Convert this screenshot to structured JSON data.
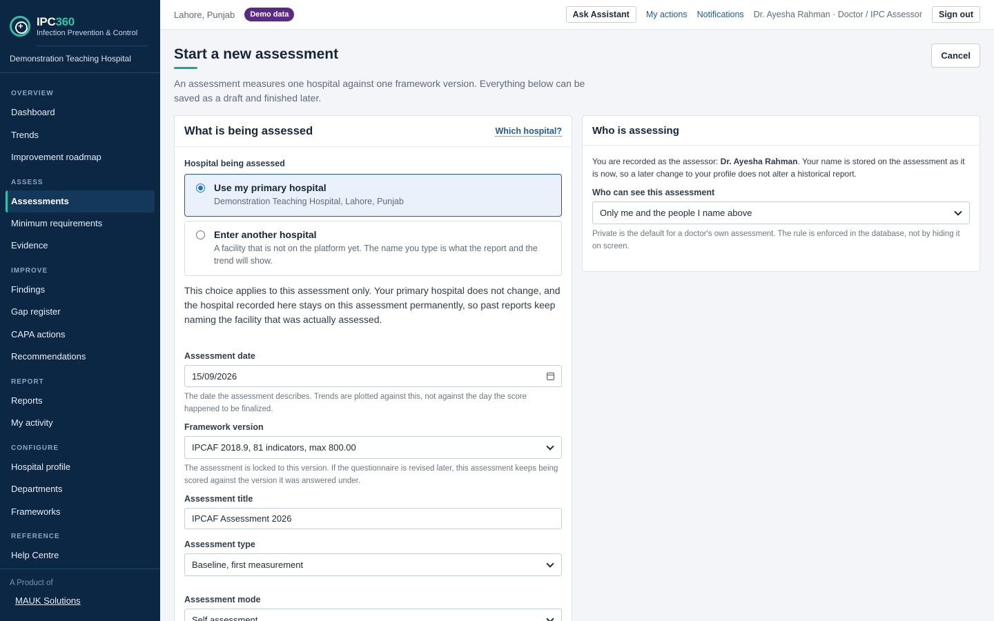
{
  "brand": {
    "name_main": "IPC",
    "name_accent": "360",
    "tagline": "Infection Prevention & Control",
    "org": "Demonstration Teaching Hospital"
  },
  "sidebar": {
    "sections": [
      {
        "title": "OVERVIEW",
        "items": [
          "Dashboard",
          "Trends",
          "Improvement roadmap"
        ]
      },
      {
        "title": "ASSESS",
        "items": [
          "Assessments",
          "Minimum requirements",
          "Evidence"
        ]
      },
      {
        "title": "IMPROVE",
        "items": [
          "Findings",
          "Gap register",
          "CAPA actions",
          "Recommendations"
        ]
      },
      {
        "title": "REPORT",
        "items": [
          "Reports",
          "My activity"
        ]
      },
      {
        "title": "CONFIGURE",
        "items": [
          "Hospital profile",
          "Departments",
          "Frameworks"
        ]
      },
      {
        "title": "REFERENCE",
        "items": [
          "Help Centre"
        ]
      }
    ],
    "active_item": "Assessments",
    "footer_label": "A Product of",
    "footer_link": "MAUK Solutions"
  },
  "topbar": {
    "location": "Lahore, Punjab",
    "badge": "Demo data",
    "ask_assistant": "Ask Assistant",
    "my_actions": "My actions",
    "notifications": "Notifications",
    "user": "Dr. Ayesha Rahman · Doctor / IPC Assessor",
    "sign_out": "Sign out"
  },
  "page": {
    "title": "Start a new assessment",
    "intro": "An assessment measures one hospital against one framework version. Everything below can be saved as a draft and finished later.",
    "cancel": "Cancel"
  },
  "assessed_card": {
    "title": "What is being assessed",
    "help_link": "Which hospital?",
    "hospital_label": "Hospital being assessed",
    "option_primary_title": "Use my primary hospital",
    "option_primary_desc": "Demonstration Teaching Hospital, Lahore, Punjab",
    "option_other_title": "Enter another hospital",
    "option_other_desc": "A facility that is not on the platform yet. The name you type is what the report and the trend will show.",
    "choice_note": "This choice applies to this assessment only. Your primary hospital does not change, and the hospital recorded here stays on this assessment permanently, so past reports keep naming the facility that was actually assessed.",
    "date_label": "Assessment date",
    "date_value": "15/09/2026",
    "date_help": "The date the assessment describes. Trends are plotted against this, not against the day the score happened to be finalized.",
    "framework_label": "Framework version",
    "framework_value": "IPCAF 2018.9, 81 indicators, max 800.00",
    "framework_help": "The assessment is locked to this version. If the questionnaire is revised later, this assessment keeps being scored against the version it was answered under.",
    "title_label": "Assessment title",
    "title_value": "IPCAF Assessment 2026",
    "type_label": "Assessment type",
    "type_value": "Baseline, first measurement",
    "mode_label": "Assessment mode",
    "mode_value": "Self assessment"
  },
  "assessor_card": {
    "title": "Who is assessing",
    "text_before": "You are recorded as the assessor: ",
    "assessor_name": "Dr. Ayesha Rahman",
    "text_after": ". Your name is stored on the assessment as it is now, so a later change to your profile does not alter a historical report.",
    "visibility_label": "Who can see this assessment",
    "visibility_value": "Only me and the people I name above",
    "visibility_help": "Private is the default for a doctor's own assessment. The rule is enforced in the database, not by hiding it on screen."
  },
  "colors": {
    "sidebar_bg": "#0c2743",
    "accent": "#2cc4a9",
    "link": "#1d5aa6",
    "badge": "#5b2a86"
  }
}
